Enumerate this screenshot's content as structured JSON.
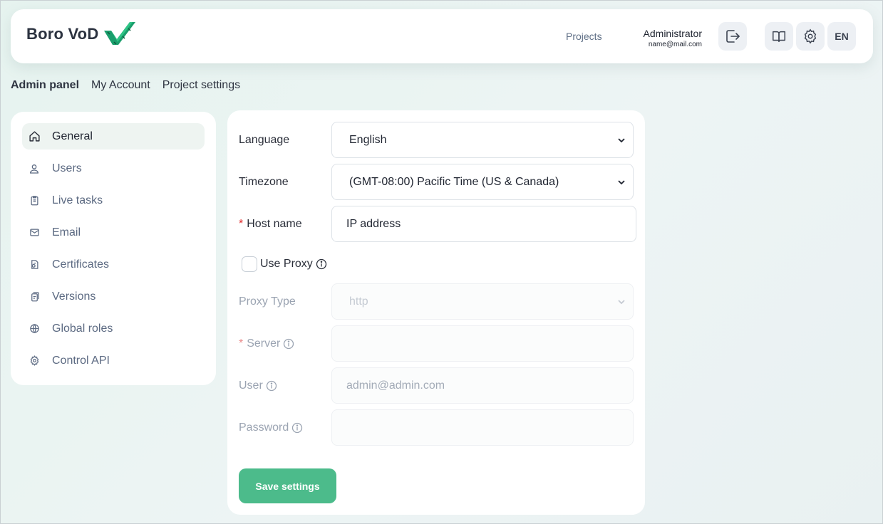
{
  "brand": {
    "name": "Boro VoD",
    "accent": "#1a9e6c"
  },
  "header": {
    "projects_link": "Projects",
    "user_name": "Administrator",
    "user_email": "name@mail.com",
    "logout_icon": "logout-icon",
    "docs_icon": "book-icon",
    "settings_icon": "gear-icon",
    "language": "EN"
  },
  "tabs": [
    {
      "label": "Admin panel",
      "active": true
    },
    {
      "label": "My Account",
      "active": false
    },
    {
      "label": "Project settings",
      "active": false
    }
  ],
  "sidebar": {
    "items": [
      {
        "label": "General",
        "icon": "home-icon",
        "active": true
      },
      {
        "label": "Users",
        "icon": "user-icon",
        "active": false
      },
      {
        "label": "Live tasks",
        "icon": "clipboard-icon",
        "active": false
      },
      {
        "label": "Email",
        "icon": "mail-icon",
        "active": false
      },
      {
        "label": "Certificates",
        "icon": "certificate-icon",
        "active": false
      },
      {
        "label": "Versions",
        "icon": "versions-icon",
        "active": false
      },
      {
        "label": "Global roles",
        "icon": "globe-icon",
        "active": false
      },
      {
        "label": "Control API",
        "icon": "gear-small-icon",
        "active": false
      }
    ]
  },
  "form": {
    "language": {
      "label": "Language",
      "value": "English"
    },
    "timezone": {
      "label": "Timezone",
      "value": "(GMT-08:00) Pacific Time (US & Canada)"
    },
    "host_name": {
      "label": "Host name",
      "required_mark": "*",
      "value": "IP address"
    },
    "use_proxy": {
      "label": "Use Proxy",
      "checked": false
    },
    "proxy_type": {
      "label": "Proxy Type",
      "value": "http",
      "disabled": true
    },
    "server": {
      "label": "Server",
      "required_mark": "*",
      "value": "",
      "disabled": true
    },
    "user": {
      "label": "User",
      "placeholder": "admin@admin.com",
      "disabled": true
    },
    "password": {
      "label": "Password",
      "value": "",
      "disabled": true
    },
    "save_label": "Save settings",
    "save_color": "#4cbb8b"
  }
}
